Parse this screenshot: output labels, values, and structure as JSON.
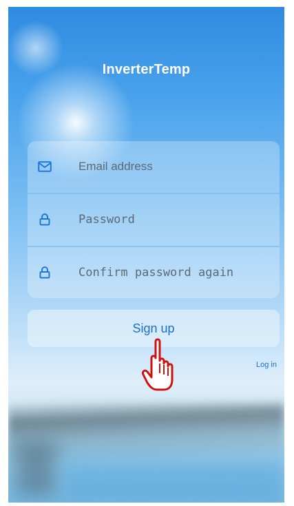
{
  "app": {
    "title": "InverterTemp"
  },
  "form": {
    "email": {
      "placeholder": "Email address",
      "icon": "mail-icon"
    },
    "password": {
      "placeholder": "Password",
      "icon": "lock-icon"
    },
    "confirm_password": {
      "placeholder": "Confirm password again",
      "icon": "lock-icon"
    }
  },
  "actions": {
    "signup_label": "Sign up",
    "login_label": "Log in"
  },
  "colors": {
    "accent": "#1b6fd0",
    "icon": "#1f78d8",
    "cursor_outline": "#cc1111"
  },
  "cursor": {
    "icon": "hand-pointer-icon"
  }
}
